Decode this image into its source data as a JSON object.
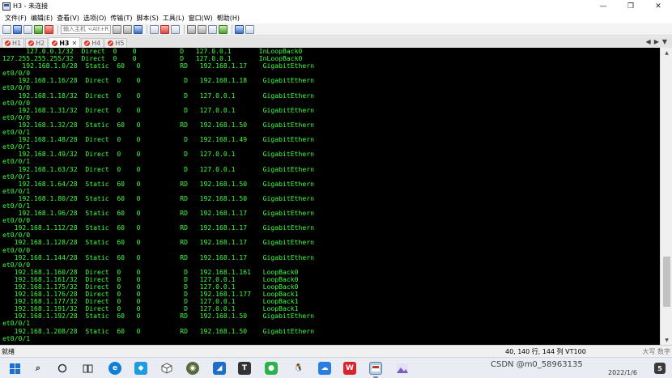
{
  "window": {
    "title": "H3 - 未连接",
    "controls": [
      "—",
      "❐",
      "✕"
    ]
  },
  "menu": [
    "文件(F)",
    "编辑(E)",
    "查看(V)",
    "选项(O)",
    "传输(T)",
    "脚本(S)",
    "工具(L)",
    "窗口(W)",
    "帮助(H)"
  ],
  "toolbar": {
    "host_placeholder": "输入主机 <Alt+R>"
  },
  "tabs": [
    {
      "label": "H1",
      "active": false,
      "closable": false
    },
    {
      "label": "H2",
      "active": false,
      "closable": false
    },
    {
      "label": "H3",
      "active": true,
      "closable": true
    },
    {
      "label": "H4",
      "active": false,
      "closable": false
    },
    {
      "label": "H5",
      "active": false,
      "closable": false
    }
  ],
  "tab_nav": [
    "◀",
    "▶",
    "▼"
  ],
  "terminal": {
    "lines": [
      "      127.0.0.1/32  Direct  0    0           D   127.0.0.1       InLoopBack0",
      "127.255.255.255/32  Direct  0    0           D   127.0.0.1       InLoopBack0",
      "     192.168.1.0/28  Static  60   0          RD   192.168.1.17    GigabitEthern",
      "et0/0/0",
      "    192.168.1.16/28  Direct  0    0           D   192.168.1.18    GigabitEthern",
      "et0/0/0",
      "    192.168.1.18/32  Direct  0    0           D   127.0.0.1       GigabitEthern",
      "et0/0/0",
      "    192.168.1.31/32  Direct  0    0           D   127.0.0.1       GigabitEthern",
      "et0/0/0",
      "    192.168.1.32/28  Static  60   0          RD   192.168.1.50    GigabitEthern",
      "et0/0/1",
      "    192.168.1.48/28  Direct  0    0           D   192.168.1.49    GigabitEthern",
      "et0/0/1",
      "    192.168.1.49/32  Direct  0    0           D   127.0.0.1       GigabitEthern",
      "et0/0/1",
      "    192.168.1.63/32  Direct  0    0           D   127.0.0.1       GigabitEthern",
      "et0/0/1",
      "    192.168.1.64/28  Static  60   0          RD   192.168.1.50    GigabitEthern",
      "et0/0/1",
      "    192.168.1.80/28  Static  60   0          RD   192.168.1.50    GigabitEthern",
      "et0/0/1",
      "    192.168.1.96/28  Static  60   0          RD   192.168.1.17    GigabitEthern",
      "et0/0/0",
      "   192.168.1.112/28  Static  60   0          RD   192.168.1.17    GigabitEthern",
      "et0/0/0",
      "   192.168.1.128/28  Static  60   0          RD   192.168.1.17    GigabitEthern",
      "et0/0/0",
      "   192.168.1.144/28  Static  60   0          RD   192.168.1.17    GigabitEthern",
      "et0/0/0",
      "   192.168.1.160/28  Direct  0    0           D   192.168.1.161   LoopBack0",
      "   192.168.1.161/32  Direct  0    0           D   127.0.0.1       LoopBack0",
      "   192.168.1.175/32  Direct  0    0           D   127.0.0.1       LoopBack0",
      "   192.168.1.176/28  Direct  0    0           D   192.168.1.177   LoopBack1",
      "   192.168.1.177/32  Direct  0    0           D   127.0.0.1       LoopBack1",
      "   192.168.1.191/32  Direct  0    0           D   127.0.0.1       LoopBack1",
      "   192.168.1.192/28  Static  60   0          RD   192.168.1.50    GigabitEthern",
      "et0/0/1",
      "   192.168.1.208/28  Static  60   0          RD   192.168.1.50    GigabitEthern",
      "et0/0/1"
    ]
  },
  "status": {
    "left": "就绪",
    "cursor": "40,  1",
    "info": "40 行, 144 列 VT100",
    "right": "大写 数字"
  },
  "taskbar": {
    "tray_text": "CSDN @m0_58963135",
    "date": "2022/1/6"
  }
}
